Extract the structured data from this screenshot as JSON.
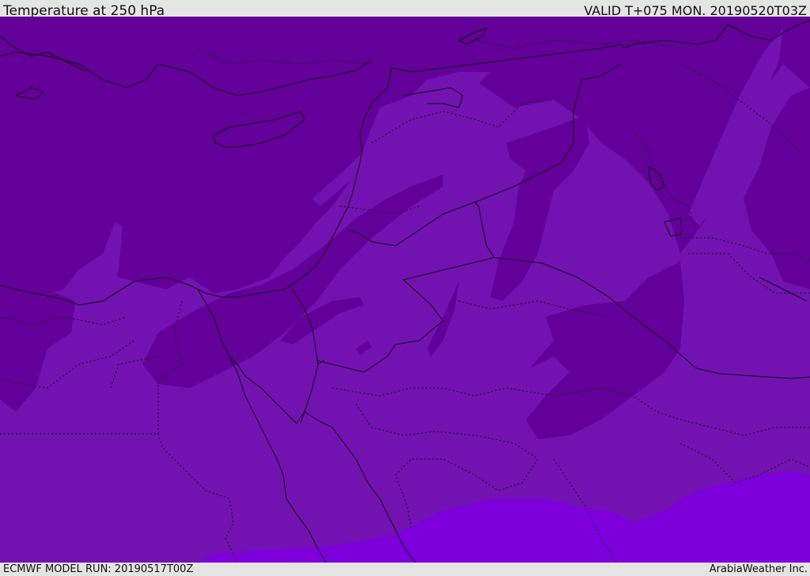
{
  "header": {
    "title": "Temperature at 250 hPa",
    "valid_time": "VALID T+075 MON. 20190520T03Z"
  },
  "footer": {
    "model_run": "ECMWF MODEL RUN: 20190517T00Z",
    "brand": "ArabiaWeather Inc."
  },
  "map": {
    "field": "temperature-250hPa",
    "palette": {
      "coldest": "#620099",
      "cold": "#7212b0",
      "mild": "#7d00dc",
      "coast": "#111111"
    }
  }
}
